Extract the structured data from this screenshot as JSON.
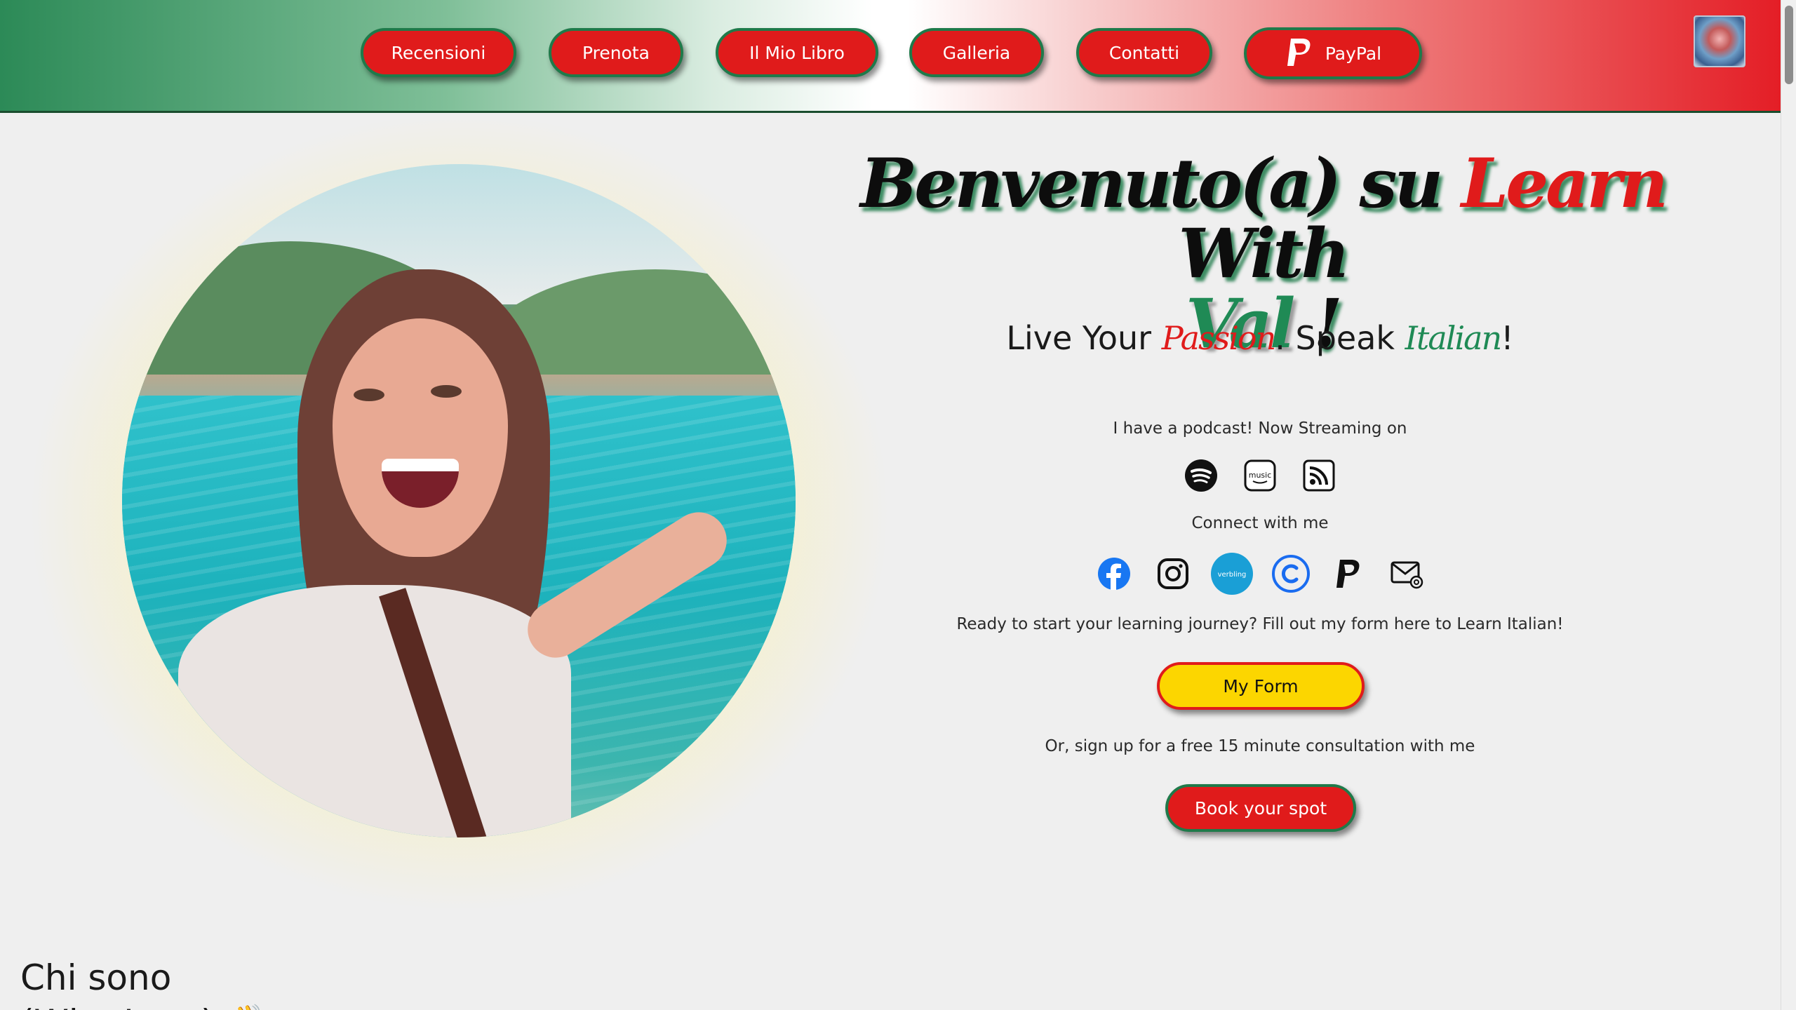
{
  "nav": {
    "items": [
      {
        "label": "Recensioni"
      },
      {
        "label": "Prenota"
      },
      {
        "label": "Il Mio Libro"
      },
      {
        "label": "Galleria"
      },
      {
        "label": "Contatti"
      },
      {
        "label": "PayPal",
        "icon": "paypal-icon"
      }
    ]
  },
  "hero": {
    "title_part1": "Benvenuto(a) su ",
    "title_red": "Learn",
    "title_part2": " With",
    "title_green": "Val",
    "title_end": " !",
    "tagline_pre": "Live Your ",
    "tagline_red": "Passion",
    "tagline_mid": ". Speak ",
    "tagline_green": "Italian",
    "tagline_end": "!"
  },
  "podcast": {
    "text": "I have a podcast! Now Streaming on",
    "icons": [
      "spotify-icon",
      "amazon-music-icon",
      "rss-icon"
    ],
    "amazon_label": "music"
  },
  "connect": {
    "text": "Connect with me",
    "icons": [
      "facebook-icon",
      "instagram-icon",
      "verbling-icon",
      "calendly-icon",
      "paypal-icon",
      "email-icon"
    ],
    "verbling_label": "verbling"
  },
  "form": {
    "text": "Ready to start your learning journey? Fill out my form here to Learn Italian!",
    "button": "My Form"
  },
  "consult": {
    "text": "Or, sign up for a free 15 minute consultation with me",
    "button": "Book your spot"
  },
  "about": {
    "heading": "Chi sono",
    "subheading": "(Who I am) 👋"
  },
  "colors": {
    "red": "#e01b1b",
    "green": "#1f8a55",
    "yellow": "#fcd600",
    "background": "#efefef"
  }
}
